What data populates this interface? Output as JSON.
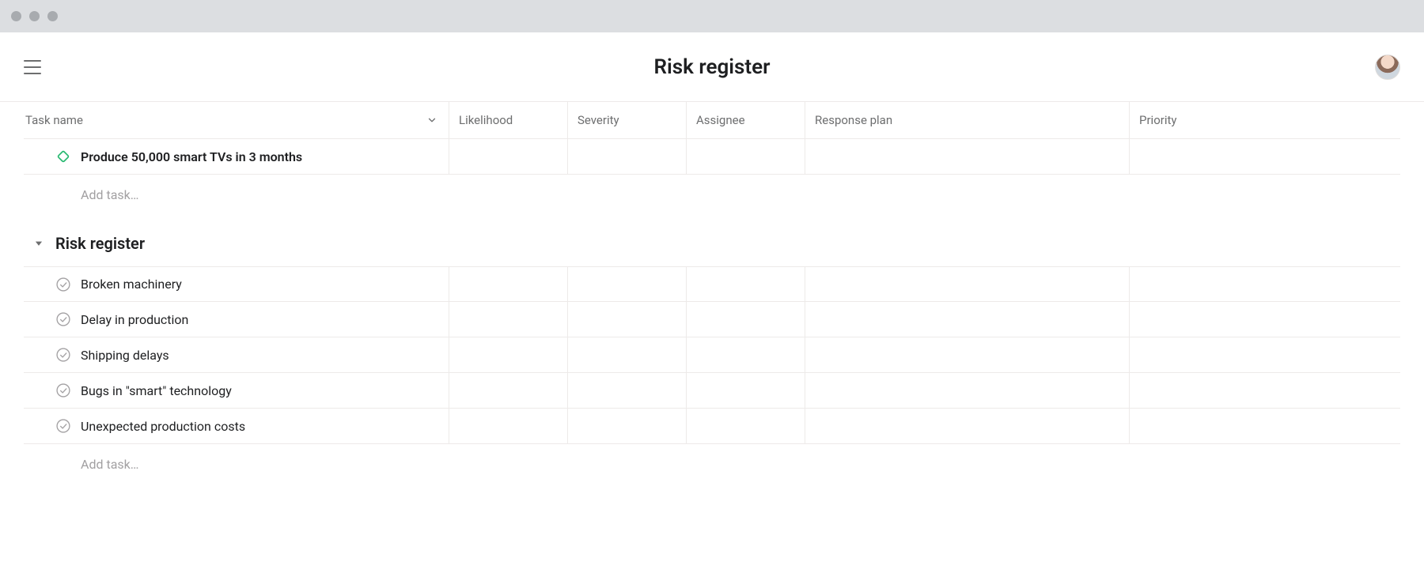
{
  "header": {
    "title": "Risk register"
  },
  "columns": {
    "task_name": "Task name",
    "likelihood": "Likelihood",
    "severity": "Severity",
    "assignee": "Assignee",
    "response_plan": "Response plan",
    "priority": "Priority"
  },
  "top_section": {
    "milestone": "Produce 50,000 smart TVs in 3 months",
    "add_task": "Add task…"
  },
  "risk_section": {
    "title": "Risk register",
    "tasks": [
      "Broken machinery",
      "Delay in production",
      "Shipping delays",
      "Bugs in \"smart\" technology",
      "Unexpected production costs"
    ],
    "add_task": "Add task…"
  }
}
